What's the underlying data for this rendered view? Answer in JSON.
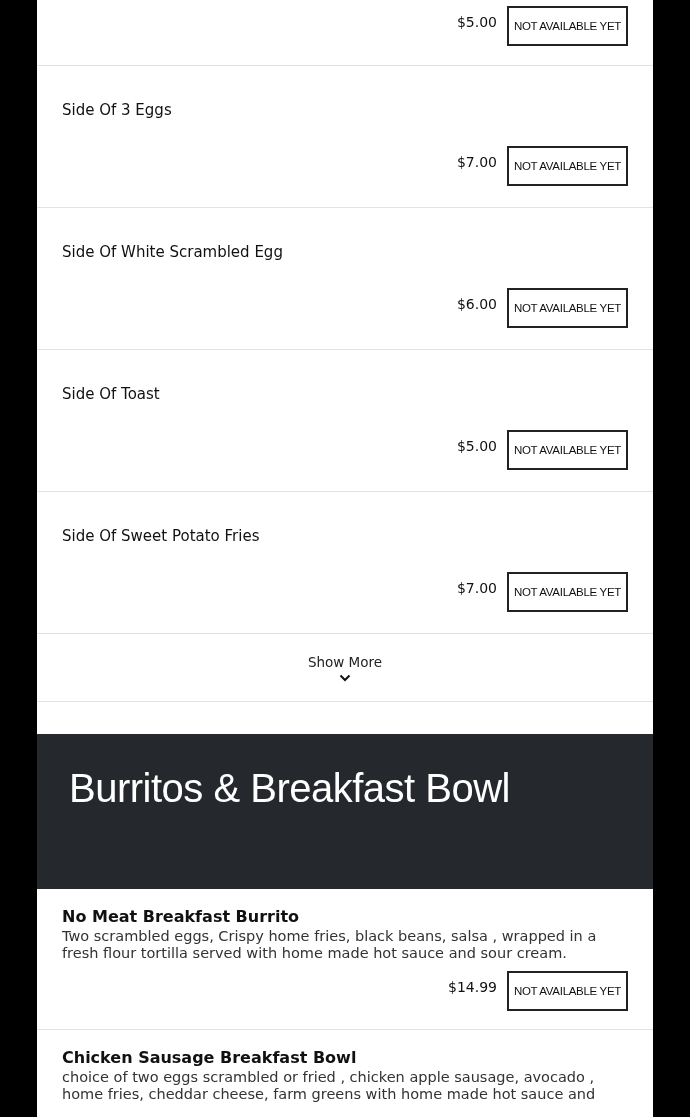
{
  "sections": [
    {
      "items": [
        {
          "price": "$5.00",
          "button": "NOT AVAILABLE YET"
        },
        {
          "name": "Side Of 3 Eggs",
          "price": "$7.00",
          "button": "NOT AVAILABLE YET"
        },
        {
          "name": "Side Of White Scrambled Egg",
          "price": "$6.00",
          "button": "NOT AVAILABLE YET"
        },
        {
          "name": "Side Of Toast",
          "price": "$5.00",
          "button": "NOT AVAILABLE YET"
        },
        {
          "name": "Side Of Sweet Potato Fries",
          "price": "$7.00",
          "button": "NOT AVAILABLE YET"
        }
      ],
      "show_more": "Show More"
    },
    {
      "title": "Burritos & Breakfast Bowl",
      "items": [
        {
          "name": "No Meat Breakfast Burrito",
          "description": "Two scrambled eggs, Crispy home fries, black beans, salsa , wrapped in a fresh flour tortilla served with home made hot sauce and sour cream.",
          "price": "$14.99",
          "button": "NOT AVAILABLE YET"
        },
        {
          "name": "Chicken Sausage Breakfast Bowl",
          "description": "choice of two eggs scrambled or fried , chicken apple sausage, avocado , home fries, cheddar cheese, farm greens with home made hot sauce and"
        }
      ]
    }
  ]
}
